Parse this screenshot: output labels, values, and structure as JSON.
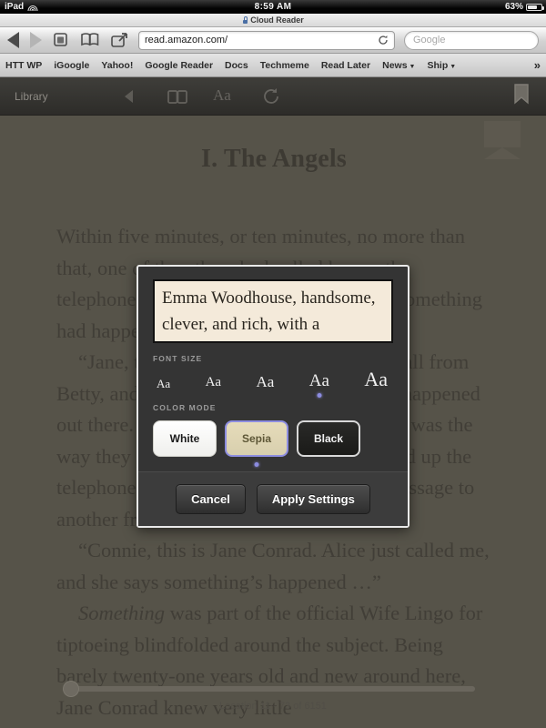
{
  "status_bar": {
    "carrier": "iPad",
    "wifi_icon": "wifi-icon",
    "time": "8:59 AM",
    "battery_percent": "63%",
    "battery_icon": "battery-icon"
  },
  "window": {
    "lock_icon": "lock-icon",
    "title": "Cloud Reader"
  },
  "browser": {
    "back_icon": "back-arrow-icon",
    "forward_icon": "forward-arrow-icon",
    "tabs_icon": "tabs-icon",
    "bookmarks_icon": "book-icon",
    "share_icon": "share-icon",
    "url": "read.amazon.com/",
    "reload_icon": "reload-icon",
    "search_placeholder": "Google",
    "bookmarks": [
      {
        "label": "HTT WP",
        "dropdown": false
      },
      {
        "label": "iGoogle",
        "dropdown": false
      },
      {
        "label": "Yahoo!",
        "dropdown": false
      },
      {
        "label": "Google Reader",
        "dropdown": false
      },
      {
        "label": "Docs",
        "dropdown": false
      },
      {
        "label": "Techmeme",
        "dropdown": false
      },
      {
        "label": "Read Later",
        "dropdown": false
      },
      {
        "label": "News",
        "dropdown": true
      },
      {
        "label": "Ship",
        "dropdown": true
      }
    ],
    "overflow_label": "»"
  },
  "reader_toolbar": {
    "library_label": "Library",
    "back_icon": "back-arrow-icon",
    "view_icon": "book-view-icon",
    "font_icon": "font-settings-icon",
    "font_icon_label": "Aa",
    "sync_icon": "sync-icon",
    "bookmark_icon": "bookmark-icon"
  },
  "book": {
    "chapter_title": "I. The Angels",
    "paragraphs": [
      "Within five minutes, or ten minutes, no more than that, one of the others had called her on the telephone to ask her if she had heard that something had happened out there.",
      "“Jane, this is Alice. Listen, I just got a call from Betty, and she said she heard something’s happened out there. Have you heard anything?” That was the way they phrased the caller call. She picked up the telephone and began relaying this same message to another framed face.",
      "“Connie, this is Jane Conrad. Alice just called me, and she says something’s happened …”",
      "Something was part of the official Wife Lingo for tiptoeing blindfolded around the subject. Being barely twenty-one years old and new around here, Jane Conrad knew very little"
    ],
    "location_text": "Location 11 - 73 of 6151"
  },
  "modal": {
    "preview_text": "Emma Woodhouse, handsome, clever, and rich, with a",
    "font_size_label": "FONT SIZE",
    "font_sizes": [
      {
        "label": "Aa",
        "px": 13,
        "selected": false
      },
      {
        "label": "Aa",
        "px": 15,
        "selected": false
      },
      {
        "label": "Aa",
        "px": 17,
        "selected": false
      },
      {
        "label": "Aa",
        "px": 19,
        "selected": true
      },
      {
        "label": "Aa",
        "px": 22,
        "selected": false
      }
    ],
    "color_mode_label": "COLOR MODE",
    "color_modes": [
      {
        "label": "White",
        "selected": false
      },
      {
        "label": "Sepia",
        "selected": true
      },
      {
        "label": "Black",
        "selected": false
      }
    ],
    "cancel_label": "Cancel",
    "apply_label": "Apply Settings",
    "accent_color": "#8c8ce0",
    "sepia_color": "#e6dcba",
    "preview_bg": "#f4eada"
  }
}
